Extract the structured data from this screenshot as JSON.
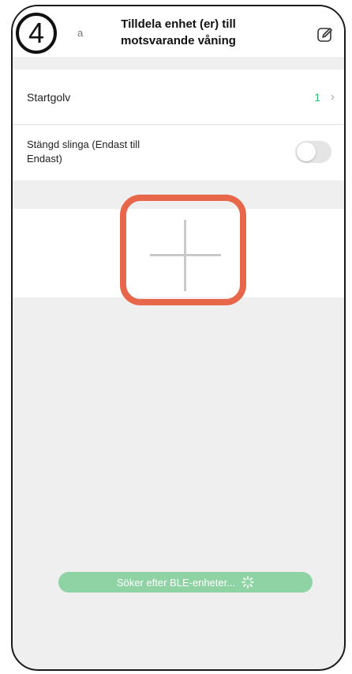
{
  "header": {
    "back_text": "a",
    "title_line1": "Tilldela enhet (er) till",
    "title_line2": "motsvarande våning",
    "edit_icon": "edit-icon"
  },
  "step_badge": "4",
  "settings": {
    "start_floor_label": "Startgolv",
    "start_floor_value": "1",
    "chevron": "›",
    "closed_loop_label": "Stängd slinga (Endast till Endast)",
    "closed_loop_enabled": false
  },
  "add_button": {
    "icon": "plus-icon",
    "highlight_color": "#e8674a"
  },
  "status": {
    "scanning_text": "Söker efter BLE-enheter...",
    "icon": "loading-spinner-icon",
    "pill_color": "#8fd3a5"
  },
  "colors": {
    "value_green": "#2fbf71"
  }
}
